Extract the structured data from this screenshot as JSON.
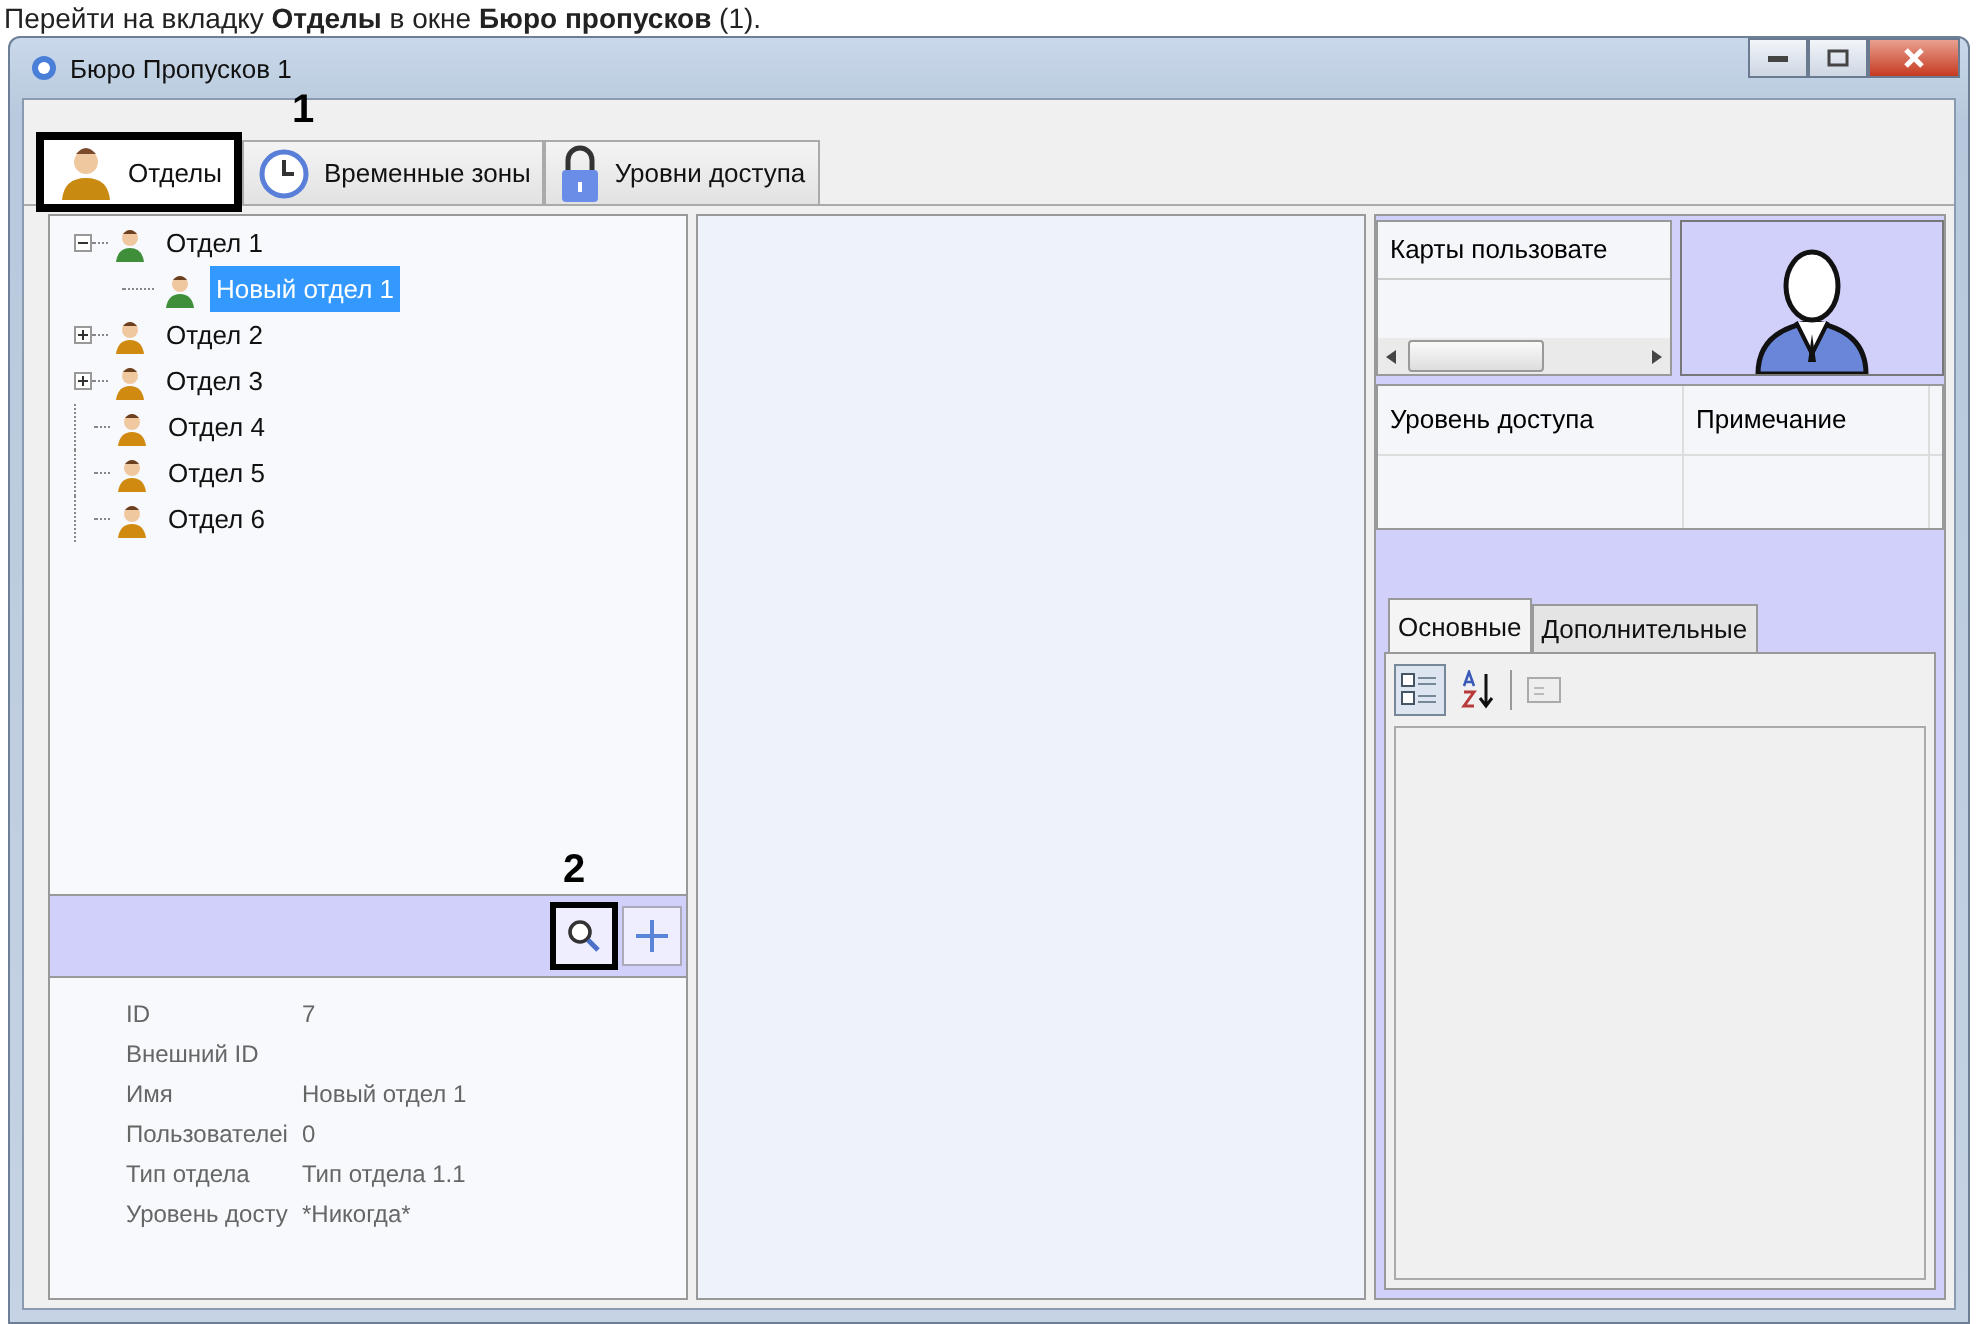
{
  "caption": "Перейти на вкладку **Отделы** в окне **Бюро пропусков** (1).",
  "window": {
    "title": "Бюро Пропусков 1"
  },
  "tabs": [
    {
      "label": "Отделы",
      "kind": "person",
      "selected": true
    },
    {
      "label": "Временные зоны",
      "kind": "clock",
      "selected": false
    },
    {
      "label": "Уровни доступа",
      "kind": "lock",
      "selected": false
    }
  ],
  "tree": [
    {
      "label": "Отдел 1",
      "color": "#3f8f3a",
      "expanded": true,
      "selected": false,
      "children": [
        {
          "label": "Новый отдел 1",
          "color": "#3f8f3a",
          "selected": true
        }
      ]
    },
    {
      "label": "Отдел 2",
      "color": "#d08a10",
      "expanded": false,
      "selected": false
    },
    {
      "label": "Отдел 3",
      "color": "#d08a10",
      "expanded": false,
      "selected": false
    },
    {
      "label": "Отдел 4",
      "color": "#d08a10",
      "selected": false
    },
    {
      "label": "Отдел 5",
      "color": "#d08a10",
      "selected": false
    },
    {
      "label": "Отдел 6",
      "color": "#d08a10",
      "selected": false
    }
  ],
  "details": [
    {
      "label": "ID",
      "value": "7"
    },
    {
      "label": "Внешний ID"
    },
    {
      "label": "Имя",
      "value": "Новый отдел 1"
    },
    {
      "label": "Пользователеі",
      "value": "0"
    },
    {
      "label": "Тип отдела",
      "value": "Тип отдела 1.1"
    },
    {
      "label": "Уровень досту",
      "value": "*Никогда*"
    }
  ],
  "cards": {
    "column_1": "Карты пользовате"
  },
  "access_table": {
    "columns": [
      "Уровень доступа",
      "Примечание"
    ]
  },
  "property_tabs": [
    {
      "label": "Основные",
      "selected": true
    },
    {
      "label": "Дополнительные",
      "selected": false
    }
  ],
  "annotations": [
    "1",
    "2"
  ]
}
